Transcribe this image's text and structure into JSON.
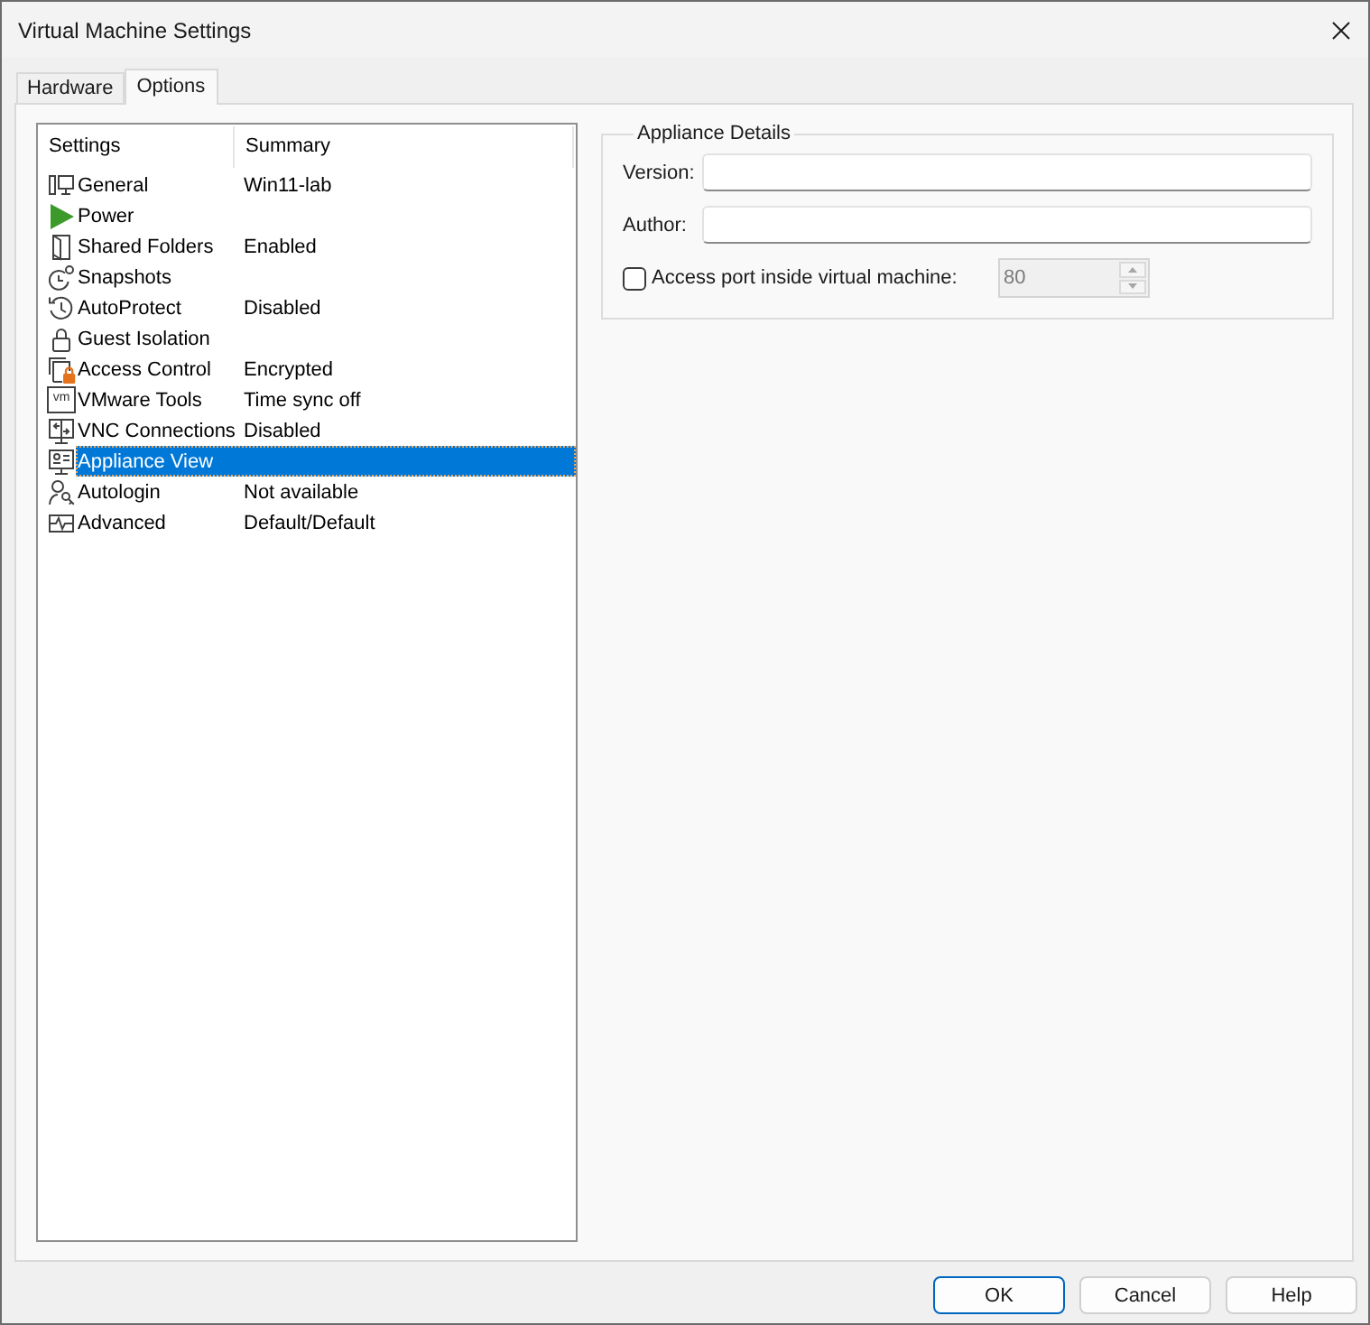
{
  "window": {
    "title": "Virtual Machine Settings"
  },
  "tabs": [
    {
      "label": "Hardware",
      "selected": false
    },
    {
      "label": "Options",
      "selected": true
    }
  ],
  "settings_list": {
    "columns": [
      "Settings",
      "Summary"
    ],
    "rows": [
      {
        "name": "General",
        "summary": "Win11-lab",
        "selected": false
      },
      {
        "name": "Power",
        "selected": false
      },
      {
        "name": "Shared Folders",
        "summary": "Enabled",
        "selected": false
      },
      {
        "name": "Snapshots",
        "selected": false
      },
      {
        "name": "AutoProtect",
        "summary": "Disabled",
        "selected": false
      },
      {
        "name": "Guest Isolation",
        "selected": false
      },
      {
        "name": "Access Control",
        "summary": "Encrypted",
        "selected": false
      },
      {
        "name": "VMware Tools",
        "summary": "Time sync off",
        "selected": false,
        "icon_text": "vm"
      },
      {
        "name": "VNC Connections",
        "summary": "Disabled",
        "selected": false
      },
      {
        "name": "Appliance View",
        "selected": true
      },
      {
        "name": "Autologin",
        "summary": "Not available",
        "selected": false
      },
      {
        "name": "Advanced",
        "summary": "Default/Default",
        "selected": false
      }
    ]
  },
  "appliance_details": {
    "title": "Appliance Details",
    "fields": [
      {
        "label": "Version:"
      },
      {
        "label": "Author:"
      }
    ],
    "access_port": {
      "label": "Access port inside virtual machine:",
      "checked": false,
      "value": "80",
      "disabled": true
    }
  },
  "buttons": [
    {
      "label": "OK",
      "default": true
    },
    {
      "label": "Cancel",
      "default": false
    },
    {
      "label": "Help",
      "default": false
    }
  ]
}
